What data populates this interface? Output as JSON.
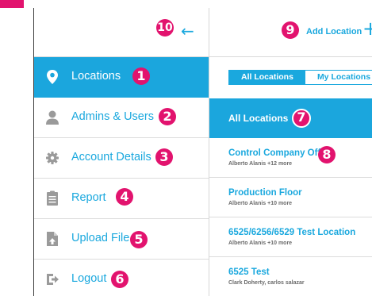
{
  "header": {
    "collapse_icon": "arrow-left-icon",
    "add_location_label": "Add Location",
    "add_icon": "plus-icon"
  },
  "annotations": [
    "1",
    "2",
    "3",
    "4",
    "5",
    "6",
    "7",
    "8",
    "9",
    "10"
  ],
  "sidebar": {
    "items": [
      {
        "label": "Locations",
        "icon": "map-pin-icon",
        "active": true
      },
      {
        "label": "Admins & Users",
        "icon": "user-icon",
        "active": false
      },
      {
        "label": "Account Details",
        "icon": "gear-icon",
        "active": false
      },
      {
        "label": "Report",
        "icon": "clipboard-icon",
        "active": false
      },
      {
        "label": "Upload File",
        "icon": "file-upload-icon",
        "active": false
      },
      {
        "label": "Logout",
        "icon": "logout-icon",
        "active": false
      }
    ]
  },
  "filter": {
    "options": [
      "All Locations",
      "My Locations"
    ],
    "selected": "All Locations"
  },
  "list": {
    "section_title": "All Locations",
    "items": [
      {
        "name": "Control Company Office",
        "sub": "Alberto Alanis +12 more"
      },
      {
        "name": "Production Floor",
        "sub": "Alberto Alanis +10 more"
      },
      {
        "name": "6525/6256/6529 Test Location",
        "sub": "Alberto Alanis +10 more"
      },
      {
        "name": "6525 Test",
        "sub": "Clark Doherty, carlos salazar"
      }
    ]
  },
  "colors": {
    "accent": "#1aa8de",
    "active_bg": "#1ba6dd",
    "badge": "#e2136e",
    "muted_icon": "#9a9a9a"
  }
}
